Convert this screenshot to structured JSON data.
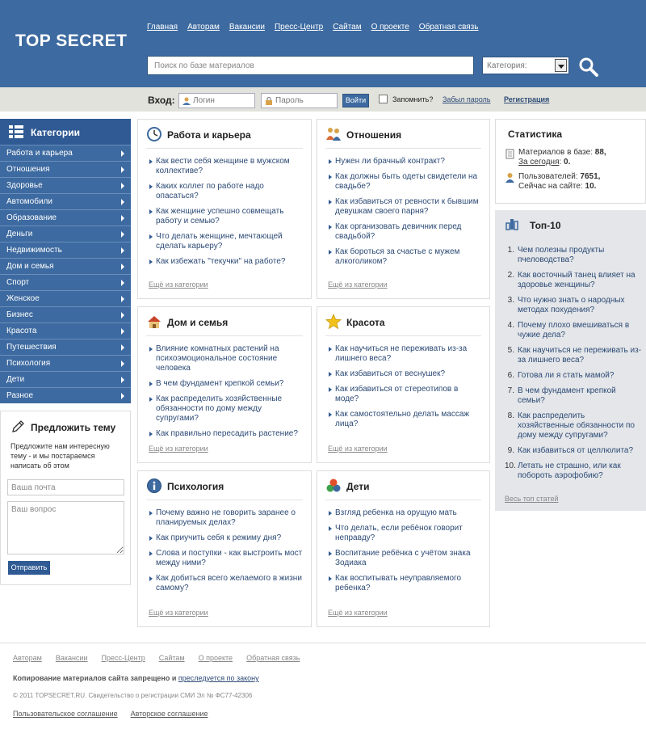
{
  "header": {
    "logo": "TOP SECRET",
    "nav": [
      "Главная",
      "Авторам",
      "Вакансии",
      "Пресс-Центр",
      "Сайтам",
      "О проекте",
      "Обратная связь"
    ],
    "search_placeholder": "Поиск по базе материалов",
    "category_select": "Категория:"
  },
  "login": {
    "label": "Вход:",
    "login_placeholder": "Логин",
    "password_placeholder": "Пароль",
    "submit": "Войти",
    "remember": "Запомнить?",
    "forgot": "Забыл пароль",
    "register": "Регистрация"
  },
  "sidebar": {
    "title": "Категории",
    "items": [
      "Работа и карьера",
      "Отношения",
      "Здоровье",
      "Автомобили",
      "Образование",
      "Деньги",
      "Недвижимость",
      "Дом и семья",
      "Спорт",
      "Женское",
      "Бизнес",
      "Красота",
      "Путешествия",
      "Психология",
      "Дети",
      "Разное"
    ]
  },
  "suggest": {
    "title": "Предложить тему",
    "text": "Предложите нам интересную тему - и мы постараемся написать об этом",
    "email_placeholder": "Ваша почта",
    "question_placeholder": "Ваш вопрос",
    "send": "Отправить"
  },
  "boxes": [
    {
      "title": "Работа и карьера",
      "icon": "clock-icon",
      "items": [
        "Как вести себя женщине в мужском коллективе?",
        "Каких коллег по работе надо опасаться?",
        "Как женщине успешно совмещать работу и семью?",
        "Что делать женщине, мечтающей сделать карьеру?",
        "Как избежать \"текучки\" на работе?"
      ],
      "more": "Ещё из категории"
    },
    {
      "title": "Отношения",
      "icon": "couple-icon",
      "items": [
        "Нужен ли брачный контракт?",
        "Как должны быть одеты свидетели на свадьбе?",
        "Как избавиться от ревности к бывшим девушкам своего парня?",
        "Как организовать девичник перед свадьбой?",
        "Как бороться за счастье с мужем алкоголиком?"
      ],
      "more": "Ещё из категории"
    },
    {
      "title": "Дом и семья",
      "icon": "house-icon",
      "items": [
        "Влияние комнатных растений на психоэмоциональное состояние человека",
        "В чем фундамент крепкой семьи?",
        "Как распределить хозяйственные обязанности по дому между супругами?",
        "Как правильно пересадить растение?"
      ],
      "more": "Ещё из категории"
    },
    {
      "title": "Красота",
      "icon": "star-icon",
      "items": [
        "Как научиться не переживать из-за лишнего веса?",
        "Как избавиться от веснушек?",
        "Как избавиться от стереотипов в моде?",
        "Как самостоятельно делать массаж лица?"
      ],
      "more": "Ещё из категории"
    },
    {
      "title": "Психология",
      "icon": "info-icon",
      "items": [
        "Почему важно не говорить заранее о планируемых делах?",
        "Как приучить себя к режиму дня?",
        "Слова и поступки - как выстроить мост между ними?",
        "Как добиться всего желаемого в жизни самому?"
      ],
      "more": "Ещё из категории"
    },
    {
      "title": "Дети",
      "icon": "blocks-icon",
      "items": [
        "Взгляд ребенка на орущую мать",
        "Что делать, если ребёнок говорит неправду?",
        "Воспитание ребёнка с учётом знака Зодиака",
        "Как воспитывать неуправляемого ребенка?"
      ],
      "more": "Ещё из категории"
    }
  ],
  "stats": {
    "title": "Статистика",
    "materials_label": "Материалов в базе:",
    "materials_value": "88,",
    "today_label": "За сегодня",
    "today_value": "0.",
    "users_label": "Пользователей:",
    "users_value": "7651,",
    "online_label": "Сейчас на сайте:",
    "online_value": "10."
  },
  "top10": {
    "title": "Топ-10",
    "items": [
      "Чем полезны продукты пчеловодства?",
      "Как восточный танец влияет на здоровье женщины?",
      "Что нужно знать о народных методах похудения?",
      "Почему плохо вмешиваться в чужие дела?",
      "Как научиться не переживать из-за лишнего веса?",
      "Готова ли я стать мамой?",
      "В чем фундамент крепкой семьи?",
      "Как распределить хозяйственные обязанности по дому между супругами?",
      "Как избавиться от целлюлита?",
      "Летать не страшно, или как побороть аэрофобию?"
    ],
    "more": "Весь топ статей"
  },
  "footer": {
    "nav": [
      "Авторам",
      "Вакансии",
      "Пресс-Центр",
      "Сайтам",
      "О проекте",
      "Обратная связь"
    ],
    "copy_note": "Копирование материалов сайта запрещено и",
    "copy_link": "преследуется по закону",
    "copyright": "© 2011 TOPSECRET.RU. Свидетельство о регистрации СМИ Эл № ФС77-42306",
    "agreements": [
      "Пользовательское соглашение",
      "Авторское соглашение"
    ]
  }
}
